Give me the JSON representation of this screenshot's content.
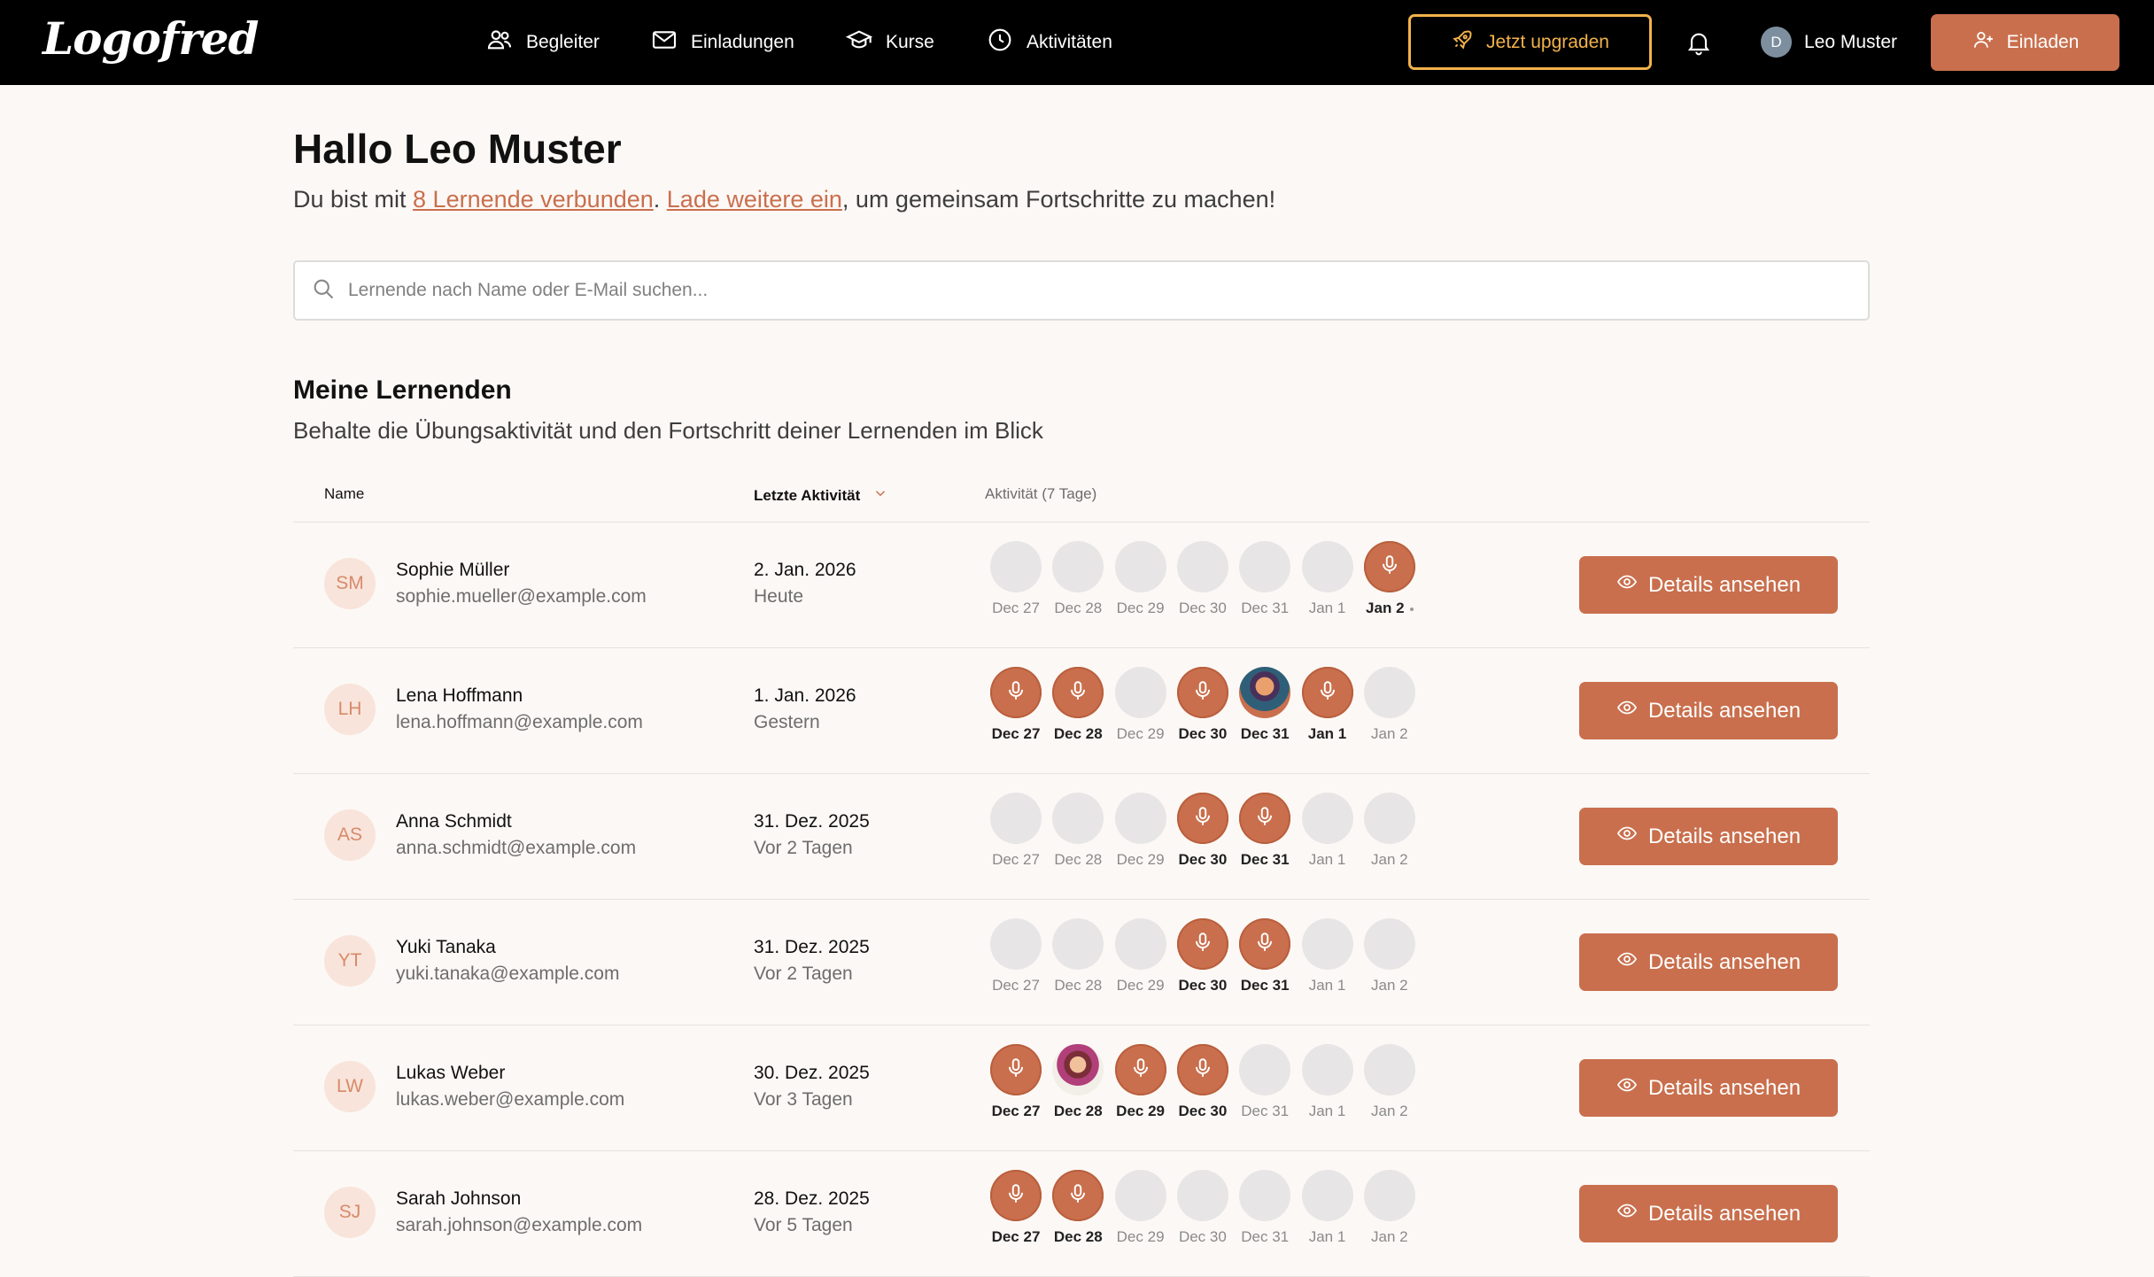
{
  "brand": {
    "logo_text": "Logofred"
  },
  "nav": [
    {
      "label": "Begleiter",
      "icon": "users-icon"
    },
    {
      "label": "Einladungen",
      "icon": "mail-icon"
    },
    {
      "label": "Kurse",
      "icon": "graduation-cap-icon"
    },
    {
      "label": "Aktivitäten",
      "icon": "clock-icon"
    }
  ],
  "header": {
    "upgrade_label": "Jetzt upgraden",
    "user_initial": "D",
    "user_name": "Leo Muster",
    "invite_label": "Einladen"
  },
  "greeting": {
    "title": "Hallo Leo Muster",
    "intro_prefix": "Du bist mit ",
    "intro_link1": "8 Lernende verbunden",
    "intro_mid": ". ",
    "intro_link2": "Lade weitere ein",
    "intro_suffix": ", um gemeinsam Fortschritte zu machen!"
  },
  "search": {
    "placeholder": "Lernende nach Name oder E-Mail suchen..."
  },
  "section": {
    "title": "Meine Lernenden",
    "subtitle": "Behalte die Übungsaktivität und den Fortschritt deiner Lernenden im Blick"
  },
  "table": {
    "col_name": "Name",
    "col_last": "Letzte Aktivität",
    "col_activity": "Aktivität (7 Tage)",
    "day_labels": [
      "Dec 27",
      "Dec 28",
      "Dec 29",
      "Dec 30",
      "Dec 31",
      "Jan 1",
      "Jan 2"
    ],
    "details_label": "Details ansehen",
    "rows": [
      {
        "initials": "SM",
        "name": "Sophie Müller",
        "email": "sophie.mueller@example.com",
        "date": "2. Jan. 2026",
        "relative": "Heute",
        "activity": [
          "none",
          "none",
          "none",
          "none",
          "none",
          "none",
          "mic"
        ]
      },
      {
        "initials": "LH",
        "name": "Lena Hoffmann",
        "email": "lena.hoffmann@example.com",
        "date": "1. Jan. 2026",
        "relative": "Gestern",
        "activity": [
          "mic",
          "mic",
          "none",
          "mic",
          "photo",
          "mic",
          "none"
        ]
      },
      {
        "initials": "AS",
        "name": "Anna Schmidt",
        "email": "anna.schmidt@example.com",
        "date": "31. Dez. 2025",
        "relative": "Vor 2 Tagen",
        "activity": [
          "none",
          "none",
          "none",
          "mic",
          "mic",
          "none",
          "none"
        ]
      },
      {
        "initials": "YT",
        "name": "Yuki Tanaka",
        "email": "yuki.tanaka@example.com",
        "date": "31. Dez. 2025",
        "relative": "Vor 2 Tagen",
        "activity": [
          "none",
          "none",
          "none",
          "mic",
          "mic",
          "none",
          "none"
        ]
      },
      {
        "initials": "LW",
        "name": "Lukas Weber",
        "email": "lukas.weber@example.com",
        "date": "30. Dez. 2025",
        "relative": "Vor 3 Tagen",
        "activity": [
          "mic",
          "photo2",
          "mic",
          "mic",
          "none",
          "none",
          "none"
        ]
      },
      {
        "initials": "SJ",
        "name": "Sarah Johnson",
        "email": "sarah.johnson@example.com",
        "date": "28. Dez. 2025",
        "relative": "Vor 5 Tagen",
        "activity": [
          "mic",
          "mic",
          "none",
          "none",
          "none",
          "none",
          "none"
        ]
      }
    ]
  },
  "colors": {
    "accent": "#c96f4d",
    "upgrade": "#f2b24b",
    "topbar": "#000000",
    "background": "#fcf8f5"
  }
}
